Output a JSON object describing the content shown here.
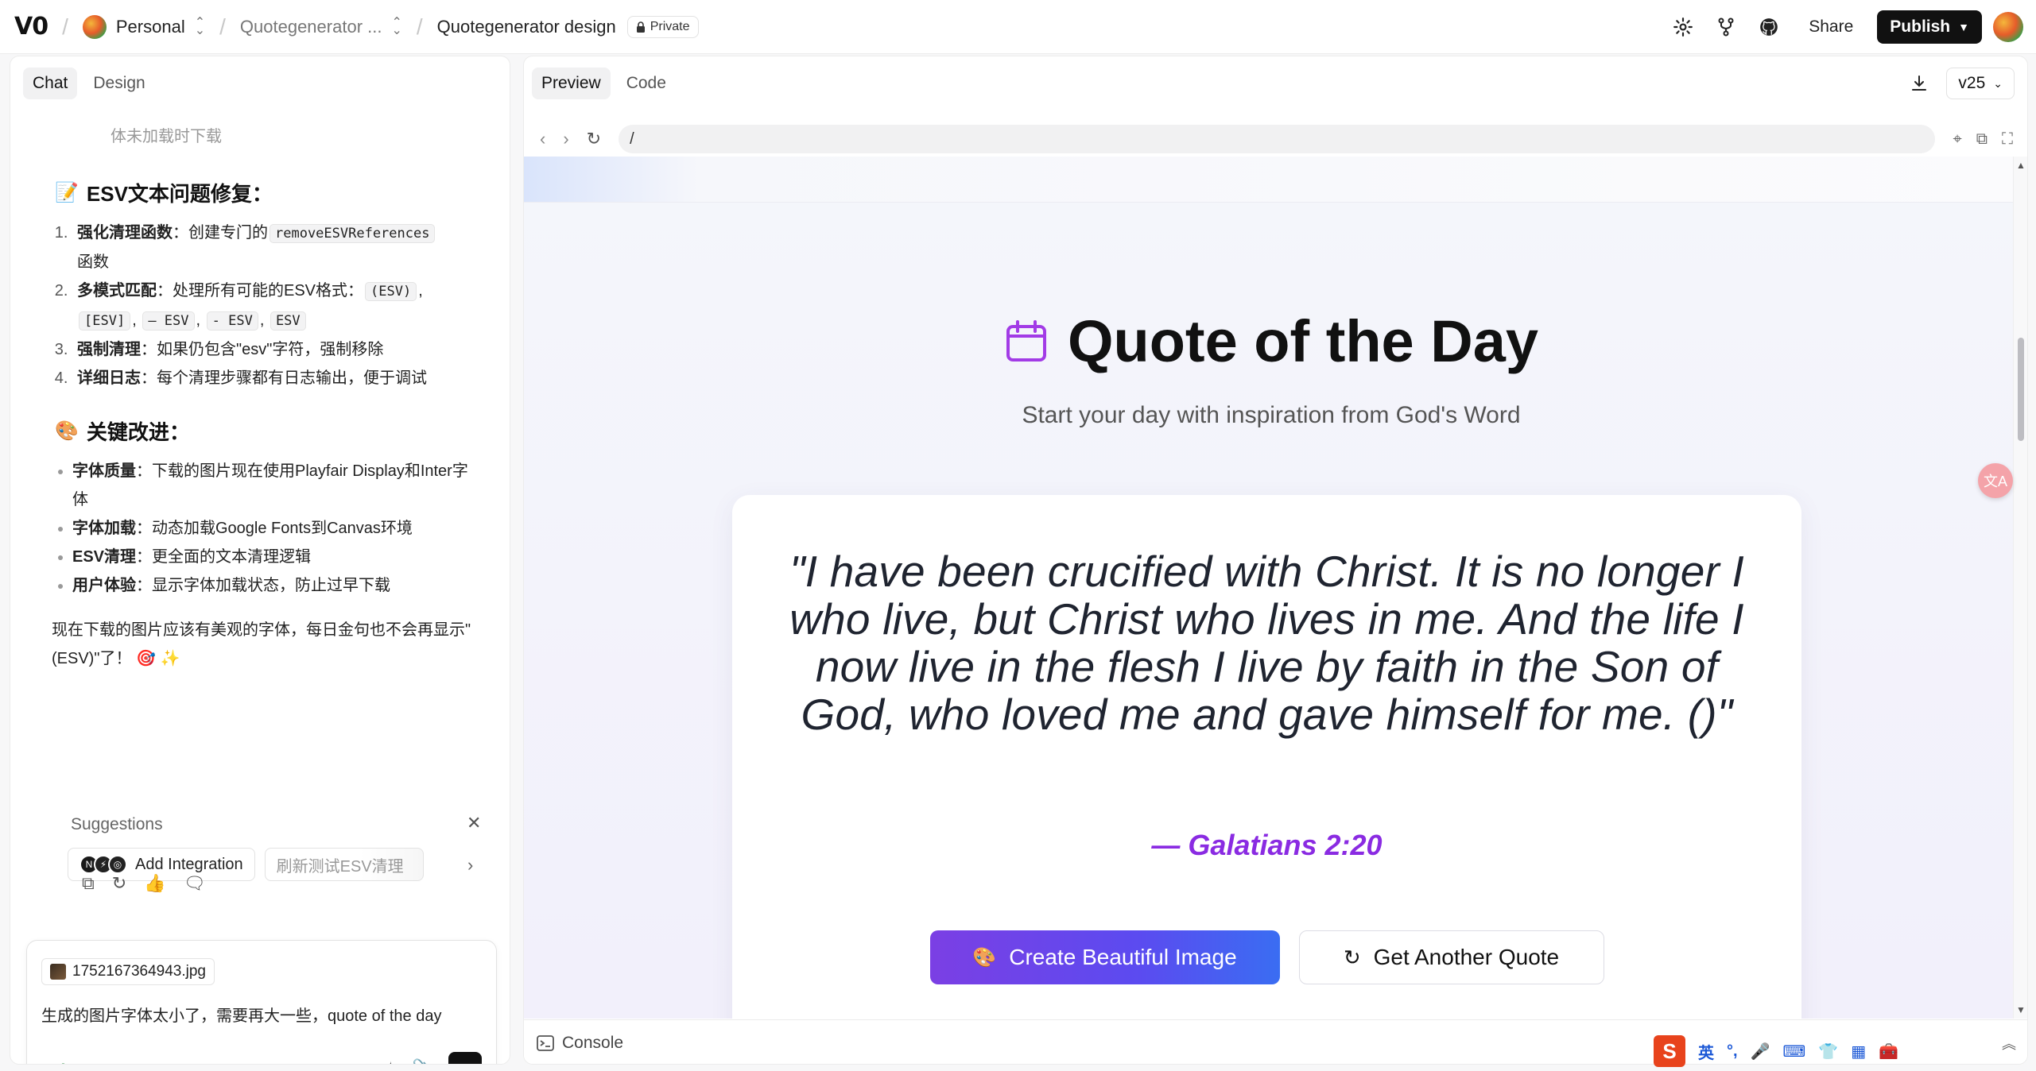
{
  "topbar": {
    "logo": "V0",
    "workspace": "Personal",
    "project": "Quotegenerator ...",
    "page": "Quotegenerator design",
    "private_label": "Private",
    "share_label": "Share",
    "publish_label": "Publish"
  },
  "left": {
    "tabs": [
      {
        "label": "Chat",
        "active": true
      },
      {
        "label": "Design",
        "active": false
      }
    ],
    "faded_line": "体未加载时下载",
    "section1": {
      "emoji": "📝",
      "title": "ESV文本问题修复：",
      "items": [
        {
          "bold": "强化清理函数",
          "text_a": "：创建专门的",
          "code": "removeESVReferences",
          "text_b": "函数"
        },
        {
          "bold": "多模式匹配",
          "text_a": "：处理所有可能的ESV格式：",
          "codes": [
            "(ESV)",
            "[ESV]",
            "– ESV",
            "- ESV",
            "ESV"
          ]
        },
        {
          "bold": "强制清理",
          "text_a": "：如果仍包含\"esv\"字符，强制移除"
        },
        {
          "bold": "详细日志",
          "text_a": "：每个清理步骤都有日志输出，便于调试"
        }
      ]
    },
    "section2": {
      "emoji": "🎨",
      "title": "关键改进：",
      "items": [
        {
          "bold": "字体质量",
          "text": "：下载的图片现在使用Playfair Display和Inter字体"
        },
        {
          "bold": "字体加载",
          "text": "：动态加载Google Fonts到Canvas环境"
        },
        {
          "bold": "ESV清理",
          "text": "：更全面的文本清理逻辑"
        },
        {
          "bold": "用户体验",
          "text": "：显示字体加载状态，防止过早下载"
        }
      ]
    },
    "closing": "现在下载的图片应该有美观的字体，每日金句也不会再显示\"(ESV)\"了！ 🎯 ✨",
    "suggestions_label": "Suggestions",
    "suggestions": [
      "Add Integration",
      "刷新测试ESV清理"
    ],
    "composer": {
      "attachment": "1752167364943.jpg",
      "text": "生成的图片字体太小了，需要再大一些，quote of the day"
    }
  },
  "right": {
    "tabs": [
      {
        "label": "Preview",
        "active": true
      },
      {
        "label": "Code",
        "active": false
      }
    ],
    "version": "v25",
    "url": "/",
    "console_label": "Console"
  },
  "preview": {
    "title": "Quote of the Day",
    "subtitle": "Start your day with inspiration from God's Word",
    "quote": "\"I have been crucified with Christ. It is no longer I who live, but Christ who lives in me. And the life I now live in the flesh I live by faith in the Son of God, who loved me and gave himself for me. ()\"",
    "reference": "— Galatians 2:20",
    "create_button": "Create Beautiful Image",
    "another_button": "Get Another Quote",
    "accent_color": "#8a2be2"
  },
  "ime": {
    "lang": "英",
    "punct": "°,"
  }
}
